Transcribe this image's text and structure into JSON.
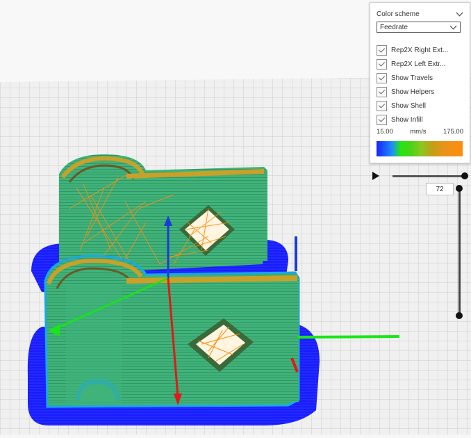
{
  "panel": {
    "title": "Color scheme",
    "scheme_selected": "Feedrate",
    "options": [
      {
        "label": "Rep2X Right Ext...",
        "checked": true
      },
      {
        "label": "Rep2X Left Extr...",
        "checked": true
      },
      {
        "label": "Show Travels",
        "checked": true
      },
      {
        "label": "Show Helpers",
        "checked": true
      },
      {
        "label": "Show Shell",
        "checked": true
      },
      {
        "label": "Show Infill",
        "checked": true
      }
    ],
    "range_min": "15.00",
    "range_unit": "mm/s",
    "range_max": "175.00"
  },
  "layer": {
    "current": "72"
  },
  "colors": {
    "model_green": "#3fb37a",
    "brim_blue": "#1a1aff",
    "shell_cyan": "#19a8e6",
    "travel_orange": "#ff8c10",
    "axis_x": "#e01919",
    "axis_y": "#19e619",
    "axis_z": "#1a3cd6"
  }
}
